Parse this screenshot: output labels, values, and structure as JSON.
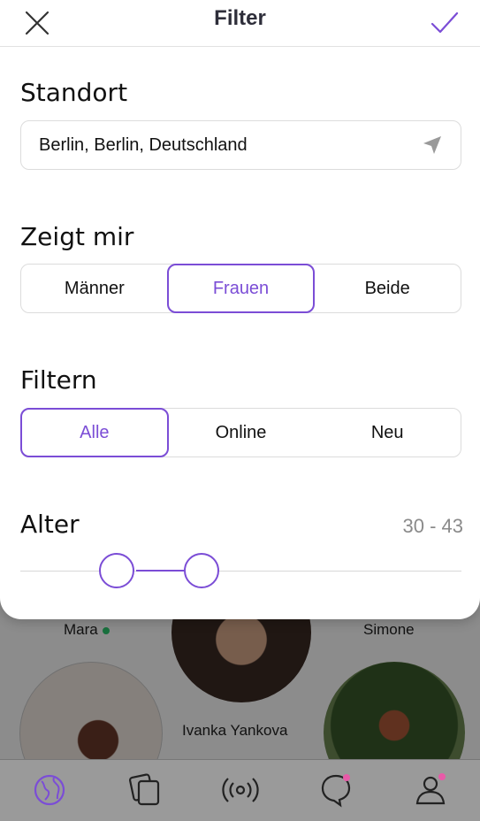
{
  "header": {
    "title": "Filter"
  },
  "location": {
    "label": "Standort",
    "value": "Berlin, Berlin, Deutschland"
  },
  "show_me": {
    "label": "Zeigt mir",
    "options": [
      "Männer",
      "Frauen",
      "Beide"
    ],
    "selected": "Frauen"
  },
  "filter": {
    "label": "Filtern",
    "options": [
      "Alle",
      "Online",
      "Neu"
    ],
    "selected": "Alle"
  },
  "age": {
    "label": "Alter",
    "value_text": "30 - 43",
    "min": 30,
    "max": 43
  },
  "background_profiles": [
    {
      "name": "Mara",
      "online": true
    },
    {
      "name": "Ivanka Yankova",
      "online": false
    },
    {
      "name": "Simone",
      "online": false
    }
  ],
  "tabbar": {
    "icons": [
      "globe-icon",
      "cards-icon",
      "radar-icon",
      "chat-icon",
      "profile-icon"
    ],
    "accent": "#7b4dd6",
    "notification_color": "#e85aa8"
  },
  "colors": {
    "accent": "#7b4dd6",
    "online": "#2ecc71"
  }
}
